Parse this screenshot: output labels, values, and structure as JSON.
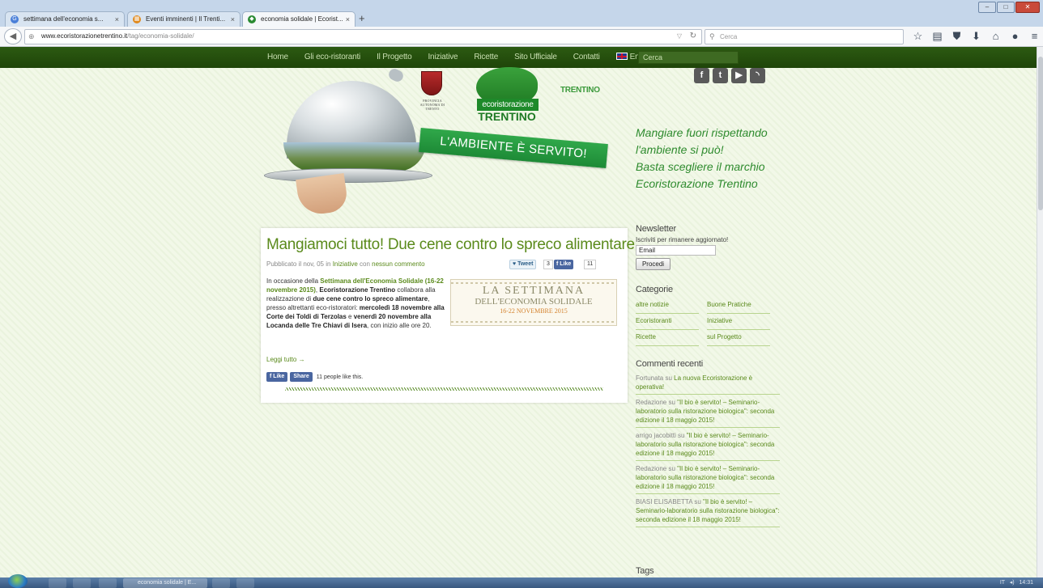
{
  "browser": {
    "tabs": [
      {
        "title": "settimana dell'economia s...",
        "icon": "google-icon"
      },
      {
        "title": "Eventi imminenti | Il Trenti...",
        "icon": "calendar-icon"
      },
      {
        "title": "economia solidale | Ecorist...",
        "icon": "ecoristorazione-icon"
      }
    ],
    "url_domain": "www.ecoristorazionetrentino.it",
    "url_path": "/tag/economia-solidale/",
    "search_placeholder": "Cerca"
  },
  "nav": {
    "items": [
      "Home",
      "Gli eco-ristoranti",
      "Il Progetto",
      "Iniziative",
      "Ricette",
      "Sito Ufficiale",
      "Contatti"
    ],
    "lang": "English",
    "search_placeholder": "Cerca"
  },
  "header": {
    "province_text": "PROVINCIA AUTONOMA DI TRENTO",
    "logo_label": "ecoristorazione",
    "logo_word": "TRENTINO",
    "trentino_brand": "TRENTINO",
    "ribbon": "L'AMBIENTE È SERVITO!",
    "social": [
      "f",
      "t",
      "▶",
      "rss"
    ],
    "tagline": [
      "Mangiare fuori rispettando",
      "l'ambiente si può!",
      "Basta scegliere il marchio",
      "Ecoristorazione Trentino"
    ]
  },
  "post": {
    "title": "Mangiamoci tutto! Due cene contro lo spreco alimentare",
    "meta_prefix": "Pubblicato il nov, 05 in ",
    "meta_category": "Iniziative",
    "meta_mid": " con ",
    "meta_comments": "nessun commento",
    "tweet_label": "Tweet",
    "tweet_count": "3",
    "like_label": "Like",
    "like_count": "11",
    "body": {
      "p1": "In occasione della ",
      "l1": "Settimana dell'Economia Solidale (16-22 novembre 2015)",
      "p2": ", ",
      "b1": "Ecoristorazione Trentino",
      "p3": " collabora alla realizzazione di ",
      "b2": "due cene contro lo spreco alimentare",
      "p4": ", presso altrettanti eco-ristoratori: ",
      "b3": "mercoledì 18 novembre alla Corte dei Toldi di Terzolas",
      "p5": " e ",
      "b4": "venerdì 20 novembre alla Locanda delle Tre Chiavi di Isera",
      "p6": ", con inizio alle ore 20."
    },
    "banner": {
      "line1": "LA SETTIMANA",
      "line2": "DELL'ECONOMIA SOLIDALE",
      "line3": "16-22 NOVEMBRE 2015"
    },
    "read_more": "Leggi tutto →",
    "fb_like": "Like",
    "fb_share": "Share",
    "fb_text": "11 people like this."
  },
  "sidebar": {
    "newsletter_heading": "Newsletter",
    "newsletter_sub": "Iscriviti per rimanere aggiornato!",
    "email_value": "Email",
    "submit_label": "Procedi",
    "categories_heading": "Categorie",
    "categories": [
      "altre notizie",
      "Buone Pratiche",
      "Ecoristoranti",
      "Iniziative",
      "Ricette",
      "sul Progetto"
    ],
    "comments_heading": "Commenti recenti",
    "comments": [
      {
        "author": "Fortunata",
        "link": "La nuova Ecoristorazione è operativa!"
      },
      {
        "author": "Redazione",
        "link": "\"Il bio è servito! – Seminario-laboratorio sulla ristorazione biologica\": seconda edizione il 18 maggio 2015!"
      },
      {
        "author": "arrigo jacobitti",
        "link": "\"Il bio è servito! – Seminario-laboratorio sulla ristorazione biologica\": seconda edizione il 18 maggio 2015!"
      },
      {
        "author": "Redazione",
        "link": "\"Il bio è servito! – Seminario-laboratorio sulla ristorazione biologica\": seconda edizione il 18 maggio 2015!"
      },
      {
        "author": "BIASI ELISABETTA",
        "link": "\"Il bio è servito! – Seminario-laboratorio sulla ristorazione biologica\": seconda edizione il 18 maggio 2015!"
      }
    ],
    "comment_joiner": " su ",
    "tags_heading": "Tags"
  },
  "taskbar": {
    "active_window": "economia solidale | E...",
    "tray_lang": "IT",
    "clock": "14:31"
  }
}
